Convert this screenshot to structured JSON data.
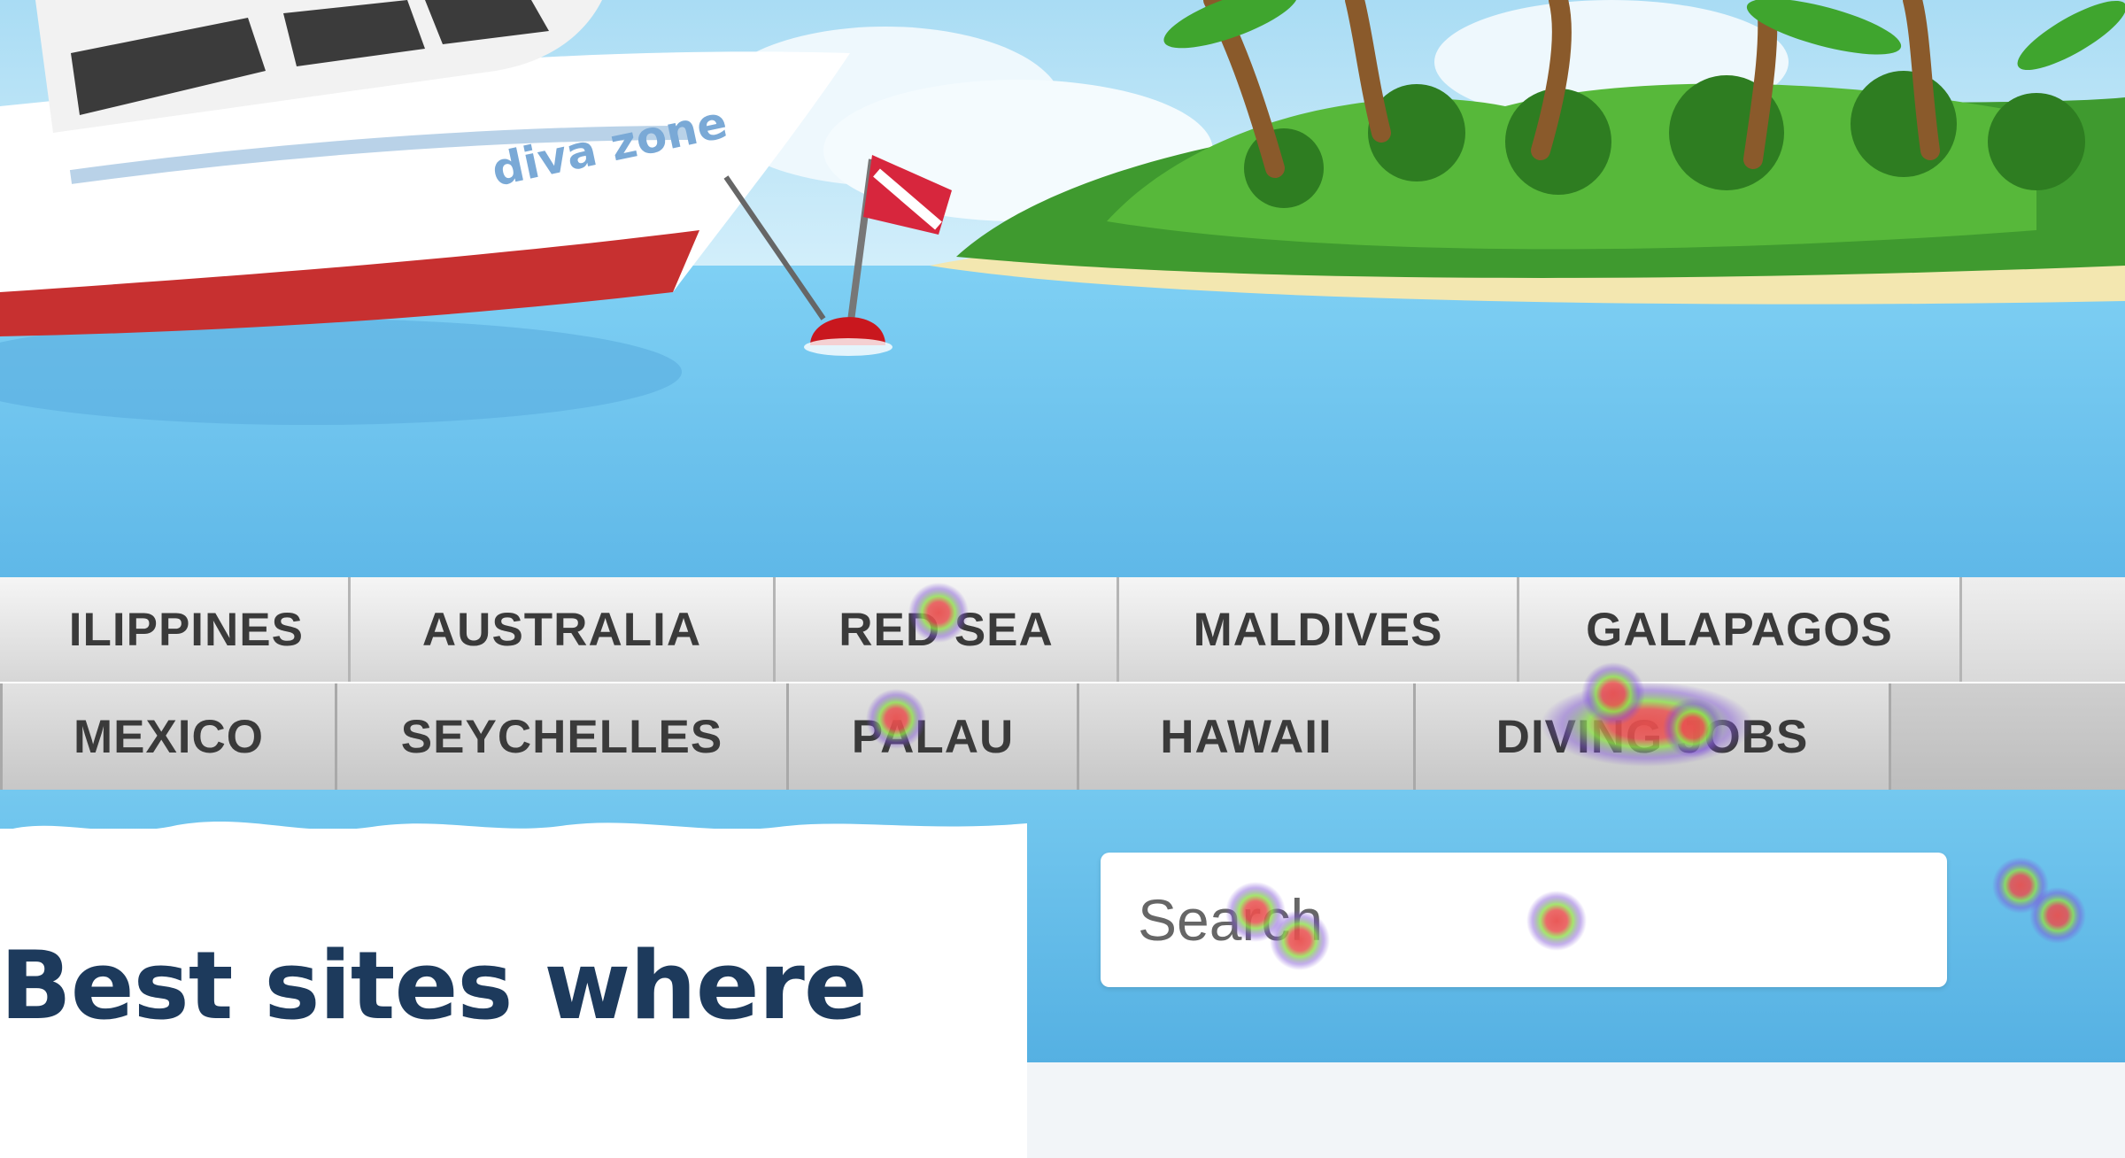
{
  "hero": {
    "boat_logo_text": "diva zone"
  },
  "nav": {
    "row1": [
      "ILIPPINES",
      "AUSTRALIA",
      "RED SEA",
      "MALDIVES",
      "GALAPAGOS"
    ],
    "row2": [
      "MEXICO",
      "SEYCHELLES",
      "PALAU",
      "HAWAII",
      "DIVING JOBS"
    ]
  },
  "main": {
    "title": "Best sites where"
  },
  "search": {
    "placeholder": "Search"
  },
  "colors": {
    "sea": "#6cc4f0",
    "sky": "#bfe6f7",
    "nav_text": "#3a3a3a",
    "title": "#1d3a5c",
    "heat_hot": "#e8504f",
    "heat_mid": "#8ee04a",
    "heat_cool": "#7d4fd6"
  },
  "icons": [
    "dive-flag-icon",
    "palm-tree-icon"
  ]
}
